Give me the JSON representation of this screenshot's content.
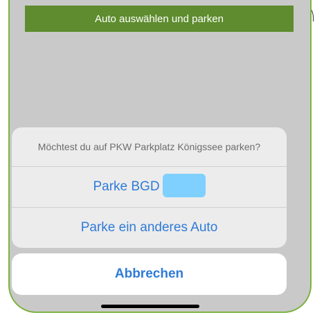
{
  "header": {
    "title": "Auto auswählen und parken"
  },
  "action_sheet": {
    "message": "Möchtest du auf PKW Parkplatz Königssee parken?",
    "options": [
      {
        "label": "Parke BGD"
      },
      {
        "label": "Parke ein anderes Auto"
      }
    ]
  },
  "cancel": {
    "label": "Abbrechen"
  },
  "colors": {
    "header_bg": "#5e8c2e",
    "accent_blue": "#2f7bd8",
    "frame_green": "#7cb342",
    "redaction": "#7fd0ff"
  }
}
